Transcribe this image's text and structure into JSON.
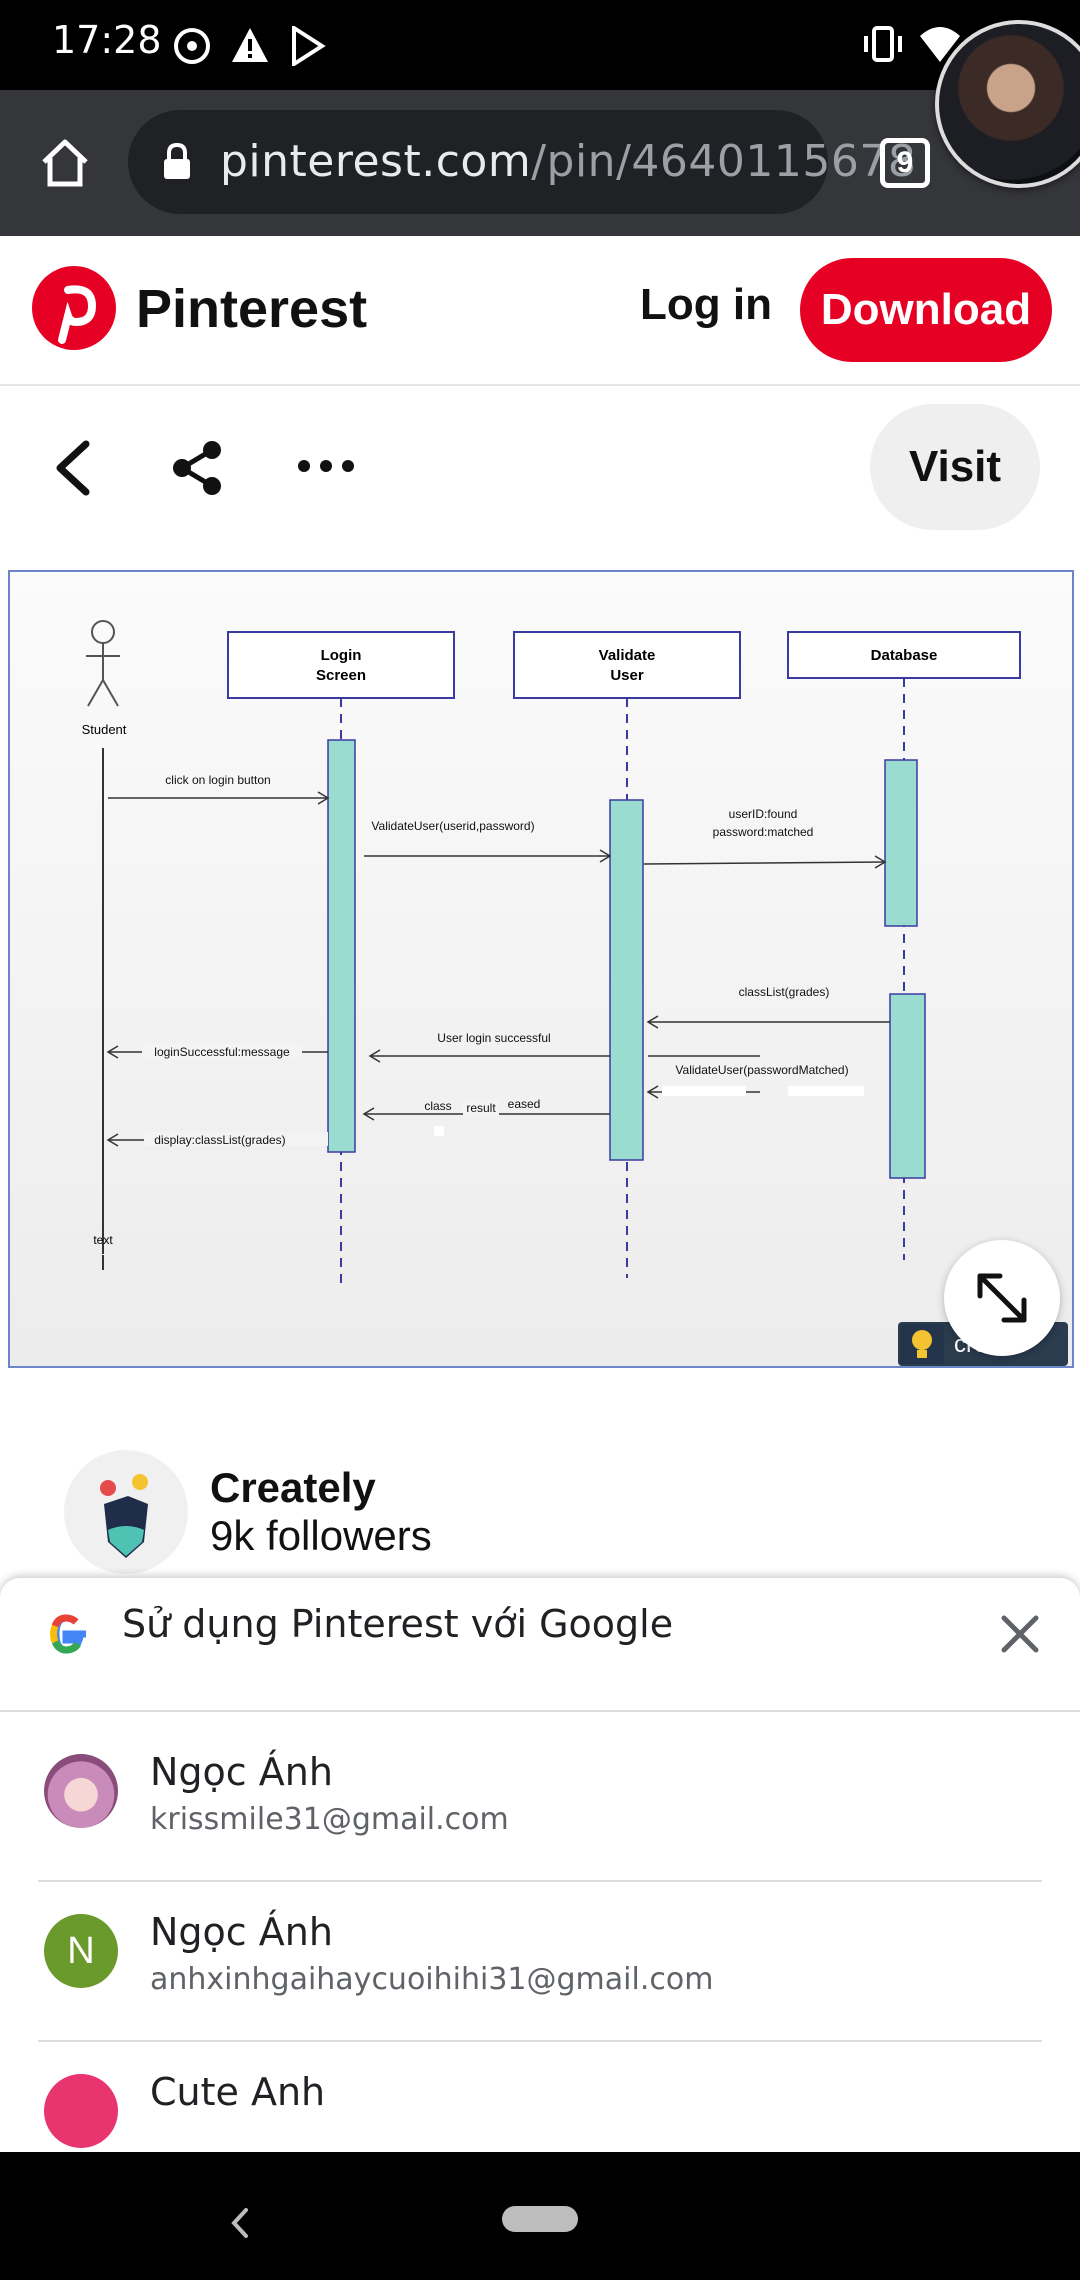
{
  "status_bar": {
    "time": "17:28"
  },
  "browser": {
    "url_host": "pinterest.com",
    "url_path": "/pin/4640115678",
    "tab_count": "9"
  },
  "pinterest_header": {
    "brand": "Pinterest",
    "login_label": "Log in",
    "download_label": "Download"
  },
  "actions": {
    "visit_label": "Visit"
  },
  "diagram": {
    "actor": "Student",
    "lifelines": [
      "Login\nScreen",
      "Validate\nUser",
      "Database"
    ],
    "messages": [
      "click on login button",
      "ValidateUser(userid,password)",
      "userID:found",
      "password:matched",
      "classList(grades)",
      "User login successful",
      "loginSuccessful:message",
      "ValidateUser(passwordMatched)",
      "class",
      "result",
      "eased",
      "display:classList(grades)",
      "text"
    ],
    "watermark": "create"
  },
  "creator": {
    "name": "Creately",
    "followers": "9k followers"
  },
  "google_sheet": {
    "title": "Sử dụng Pinterest với Google",
    "accounts": [
      {
        "name": "Ngọc Ánh",
        "email": "krissmile31@gmail.com"
      },
      {
        "name": "Ngọc Ánh",
        "email": "anhxinhgaihaycuoihihi31@gmail.com",
        "initial": "N"
      },
      {
        "name": "Cute Anh",
        "email": ""
      }
    ]
  },
  "colors": {
    "pinterest_red": "#e60023",
    "activation": "#9adccf"
  }
}
